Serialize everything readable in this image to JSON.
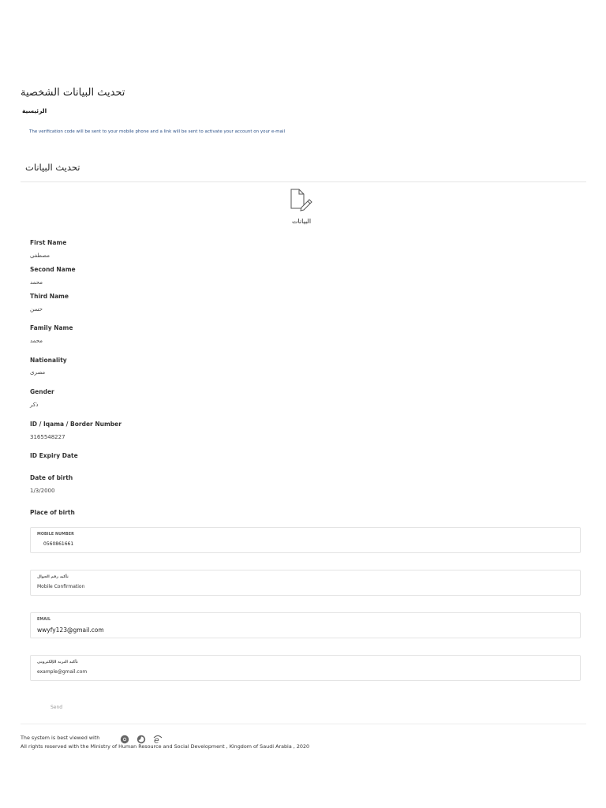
{
  "header": {
    "page_title": "تحديث البيانات الشخصية",
    "breadcrumb": "الرئيسية",
    "notice": "The verification code will be sent to your mobile phone and a link will be sent to activate your account on your e-mail"
  },
  "section": {
    "title": "تحديث البيانات",
    "icon": "document-edit-icon",
    "icon_label": "البيانات"
  },
  "fields": [
    {
      "label": "First Name",
      "value": "مصطفى"
    },
    {
      "label": "Second Name",
      "value": "محمد"
    },
    {
      "label": "Third Name",
      "value": "حسن"
    },
    {
      "label": "Family Name",
      "value": "محمد"
    },
    {
      "label": "Nationality",
      "value": "مصرى"
    },
    {
      "label": "Gender",
      "value": "ذكر"
    },
    {
      "label": "ID / Iqama / Border Number",
      "value": "3165548227"
    },
    {
      "label": "ID Expiry Date",
      "value": ""
    },
    {
      "label": "Date of birth",
      "value": "1/3/2000"
    },
    {
      "label": "Place of birth",
      "value": ""
    }
  ],
  "inputs": {
    "mobile": {
      "caption": "MOBILE NUMBER",
      "value": "0560861661"
    },
    "mobile_confirm": {
      "caption": "تأكيد رقم الجوال",
      "placeholder": "Mobile Confirmation"
    },
    "email": {
      "caption": "EMAIL",
      "value": "wwyfy123@gmail.com"
    },
    "email_confirm": {
      "caption": "تأكيد البريد الإلكتروني",
      "placeholder": "example@gmail.com"
    }
  },
  "actions": {
    "send_label": "Send"
  },
  "footer": {
    "best_viewed": "The system is best viewed with",
    "browsers": [
      "chrome-icon",
      "firefox-icon",
      "edge-icon"
    ],
    "rights": "All rights reserved with the Ministry of Human Resource and Social Development , Kingdom of Saudi Arabia , 2020"
  },
  "colors": {
    "notice_text": "#2a4f86",
    "border": "#e4e4e4",
    "send_text": "#999999"
  }
}
